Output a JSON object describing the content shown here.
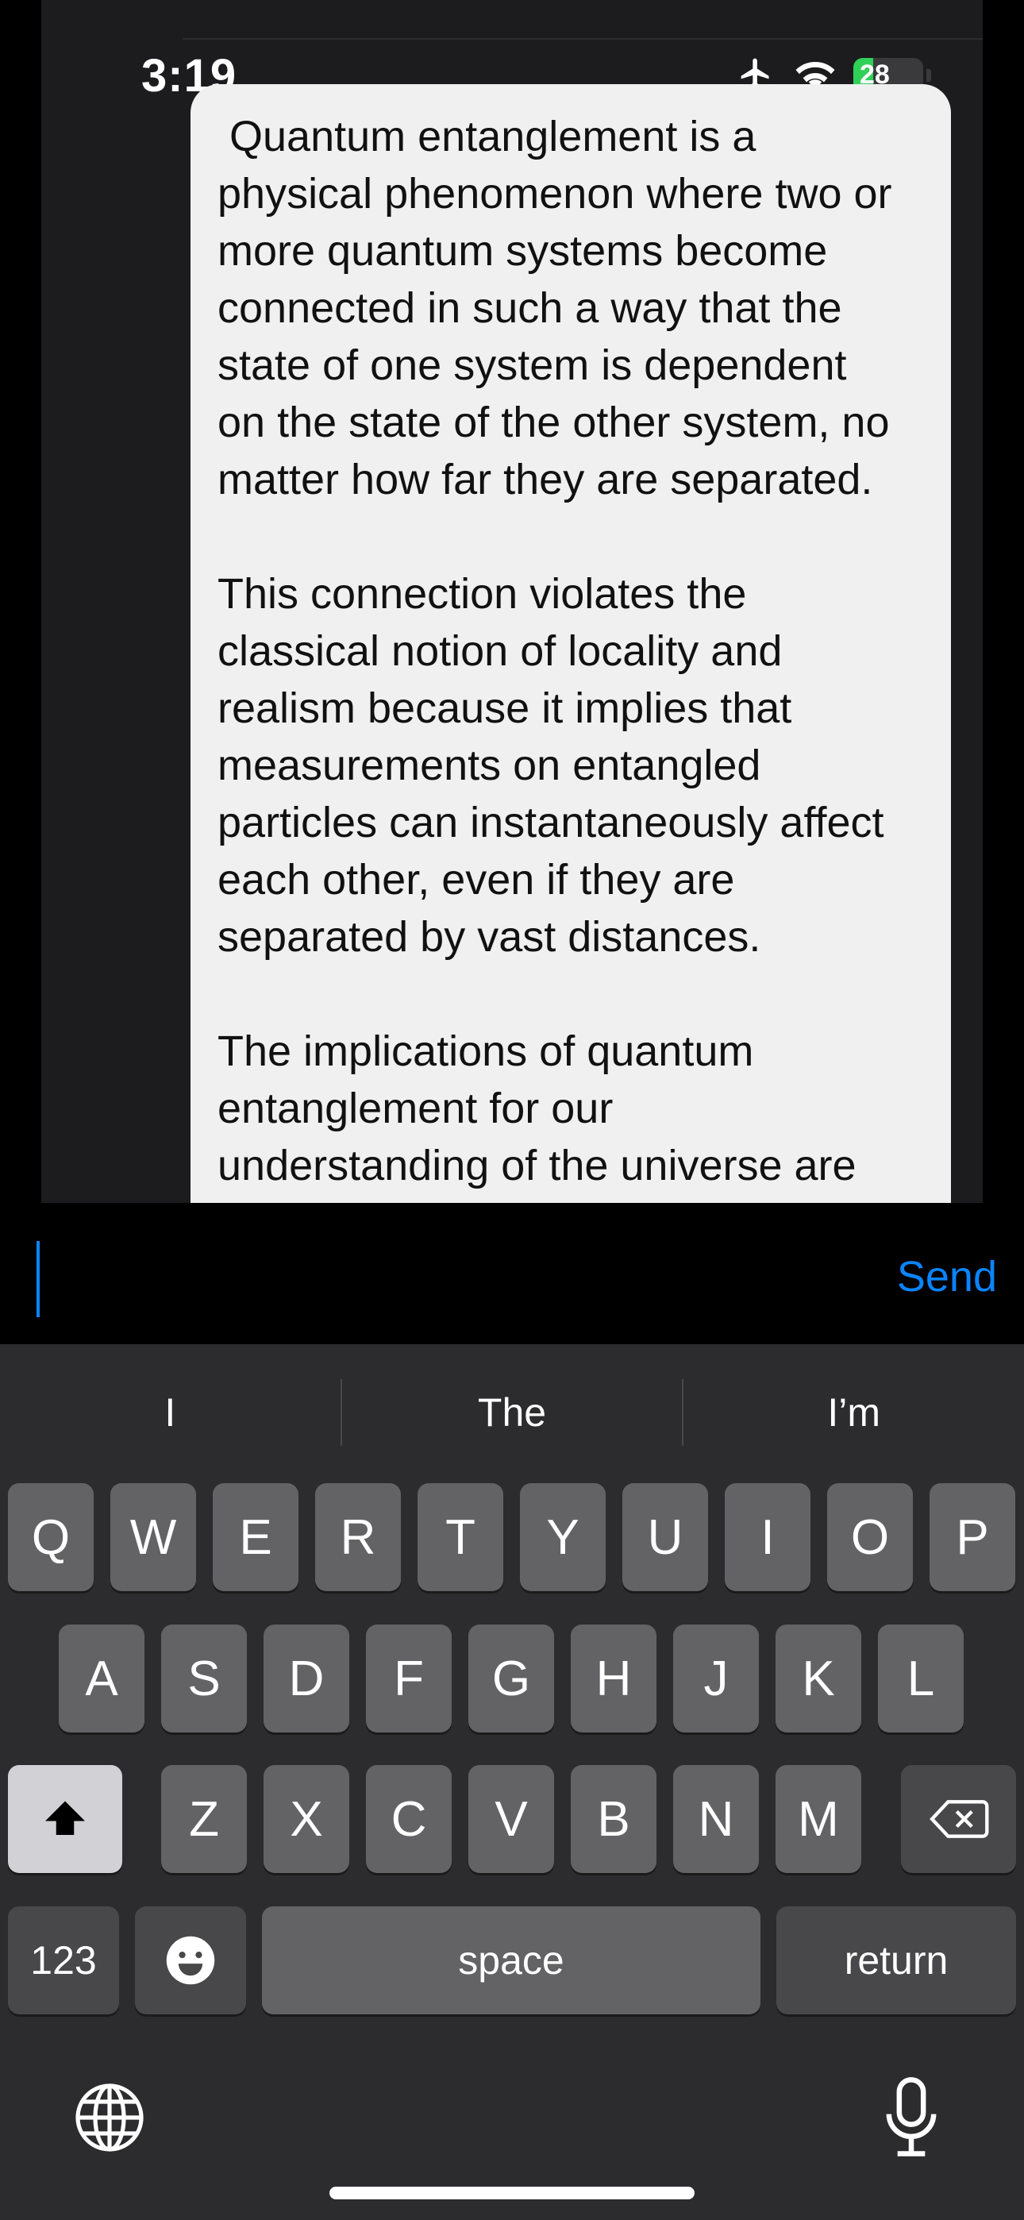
{
  "status_bar": {
    "time": "3:19",
    "battery": "28",
    "battery_percent": 28,
    "icons": [
      "airplane-icon",
      "wifi-icon",
      "battery-icon"
    ]
  },
  "message": {
    "paragraphs": [
      " Quantum entanglement is a\nphysical phenomenon where two or\nmore quantum systems become\nconnected in such a way that the\nstate of one system is dependent\non the state of the other system, no\nmatter how far they are separated.",
      "This connection violates the\nclassical notion of locality and\nrealism because it implies that\nmeasurements on entangled\nparticles can instantaneously affect\neach other, even if they are\nseparated by vast distances.",
      "The implications of quantum\nentanglement for our\nunderstanding of the universe are"
    ]
  },
  "input": {
    "value": "",
    "send_label": "Send"
  },
  "keyboard": {
    "suggestions": [
      "I",
      "The",
      "I’m"
    ],
    "row1": [
      "Q",
      "W",
      "E",
      "R",
      "T",
      "Y",
      "U",
      "I",
      "O",
      "P"
    ],
    "row2": [
      "A",
      "S",
      "D",
      "F",
      "G",
      "H",
      "J",
      "K",
      "L"
    ],
    "row3": [
      "Z",
      "X",
      "C",
      "V",
      "B",
      "N",
      "M"
    ],
    "numbers_label": "123",
    "space_label": "space",
    "return_label": "return"
  },
  "colors": {
    "accent": "#0a84ff",
    "bubble": "#f0f0f0",
    "key": "#636366",
    "keyboard_bg": "#2c2c2e"
  }
}
